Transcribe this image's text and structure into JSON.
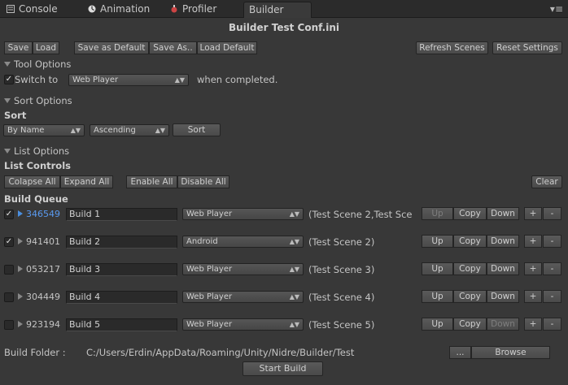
{
  "tabs": [
    {
      "label": "Console",
      "icon": "console-icon"
    },
    {
      "label": "Animation",
      "icon": "animation-icon"
    },
    {
      "label": "Profiler",
      "icon": "profiler-icon"
    },
    {
      "label": "Builder",
      "icon": ""
    }
  ],
  "tab_menu_glyph": "▾≡",
  "title": "Builder Test Conf.ini",
  "toolbar": {
    "save": "Save",
    "load": "Load",
    "save_default": "Save as Default",
    "save_as": "Save As..",
    "load_default": "Load Default",
    "refresh_scenes": "Refresh Scenes",
    "reset_settings": "Reset Settings"
  },
  "tool_options": {
    "header": "Tool Options",
    "switch_label": "Switch to",
    "switch_checked": "✓",
    "switch_target": "Web Player",
    "suffix": "when completed."
  },
  "sort_options": {
    "header": "Sort Options",
    "title": "Sort",
    "by": "By Name",
    "order": "Ascending",
    "button": "Sort"
  },
  "list_options": {
    "header": "List Options",
    "title": "List Controls",
    "collapse": "Colapse All",
    "expand": "Expand All",
    "enable": "Enable All",
    "disable": "Disable All",
    "clear": "Clear"
  },
  "queue": {
    "title": "Build Queue",
    "row_buttons": {
      "up": "Up",
      "copy": "Copy",
      "down": "Down",
      "plus": "+",
      "minus": "-"
    },
    "items": [
      {
        "checked": "✓",
        "id": "346549",
        "name": "Build 1",
        "platform": "Web Player",
        "scenes": "(Test Scene 2,Test Sce"
      },
      {
        "checked": "✓",
        "id": "941401",
        "name": "Build 2",
        "platform": "Android",
        "scenes": "(Test Scene 2)"
      },
      {
        "checked": "",
        "id": "053217",
        "name": "Build 3",
        "platform": "Web Player",
        "scenes": "(Test Scene 3)"
      },
      {
        "checked": "",
        "id": "304449",
        "name": "Build 4",
        "platform": "Web Player",
        "scenes": "(Test Scene 4)"
      },
      {
        "checked": "",
        "id": "923194",
        "name": "Build 5",
        "platform": "Web Player",
        "scenes": "(Test Scene 5)"
      }
    ]
  },
  "footer": {
    "build_folder_label": "Build Folder :",
    "build_folder_path": "C:/Users/Erdin/AppData/Roaming/Unity/Nidre/Builder/Test",
    "dots": "...",
    "browse": "Browse",
    "start_build": "Start Build"
  },
  "colors": {
    "selected_id": "#5a9af0",
    "background": "#383838"
  }
}
